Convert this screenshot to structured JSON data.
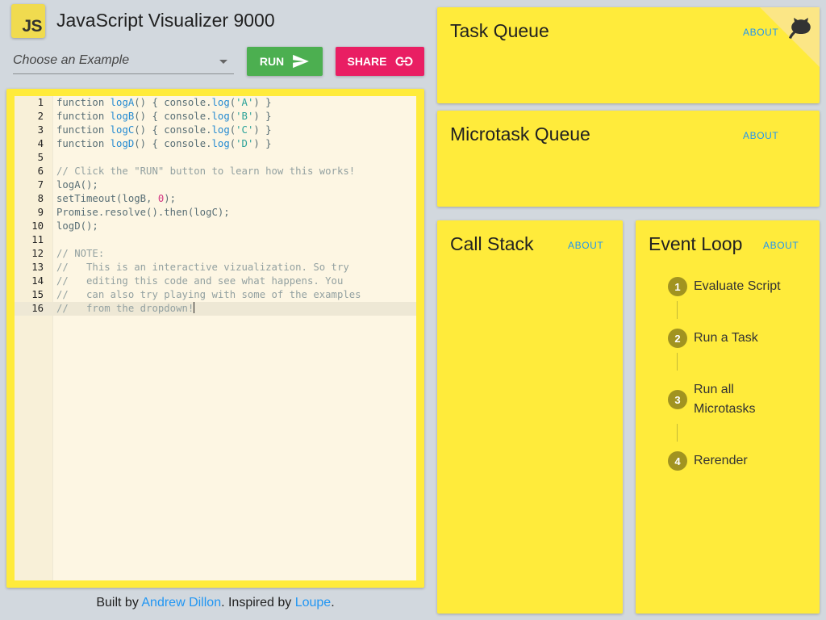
{
  "header": {
    "logo_text": "JS",
    "title": "JavaScript Visualizer 9000"
  },
  "toolbar": {
    "example_placeholder": "Choose an Example",
    "run_label": "RUN",
    "share_label": "SHARE"
  },
  "editor": {
    "line_numbers": [
      "1",
      "2",
      "3",
      "4",
      "5",
      "6",
      "7",
      "8",
      "9",
      "10",
      "11",
      "12",
      "13",
      "14",
      "15",
      "16"
    ],
    "active_line": 16
  },
  "footer": {
    "prefix": "Built by ",
    "author": "Andrew Dillon",
    "middle": ". Inspired by ",
    "inspiration": "Loupe",
    "suffix": "."
  },
  "panels": {
    "task_queue": {
      "title": "Task Queue",
      "about": "ABOUT"
    },
    "microtask_queue": {
      "title": "Microtask Queue",
      "about": "ABOUT"
    },
    "call_stack": {
      "title": "Call Stack",
      "about": "ABOUT"
    },
    "event_loop": {
      "title": "Event Loop",
      "about": "ABOUT",
      "steps": [
        {
          "num": "1",
          "label": "Evaluate Script"
        },
        {
          "num": "2",
          "label": "Run a Task"
        },
        {
          "num": "3",
          "label": "Run all Microtasks"
        },
        {
          "num": "4",
          "label": "Rerender"
        }
      ]
    }
  },
  "colors": {
    "background": "#d2d8de",
    "panel": "#ffeb3b",
    "run": "#4caf50",
    "share": "#e91e63",
    "link": "#2196f3",
    "step_badge": "#a19320"
  },
  "icons": {
    "run": "send-icon",
    "share": "link-icon",
    "corner": "github-octocat-icon",
    "select": "chevron-down-icon"
  }
}
